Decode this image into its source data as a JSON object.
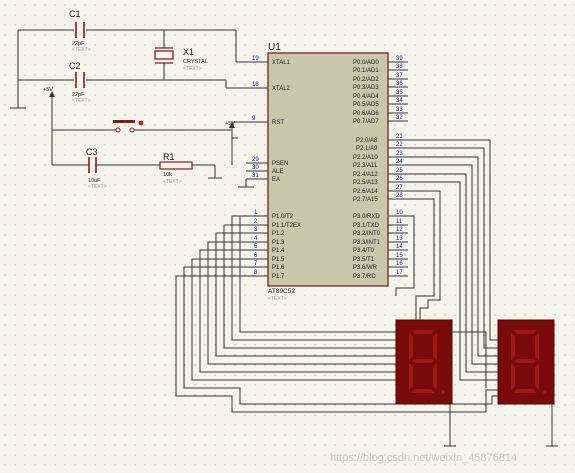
{
  "colors": {
    "background": "#f4f4ec",
    "grid_dot": "#9a9a8a",
    "wire": "#333333",
    "component_outline": "#8b1c1c",
    "chip_fill": "#c8c8ad",
    "chip_border": "#8b1c1c",
    "pin_number": "#1a1a99",
    "label": "#1a1a1a",
    "text_placeholder": "#9a9a9a",
    "segment_display_bg": "#7a0b0b",
    "segment_off": "#a01818",
    "pin_dot": "#2a2a2a"
  },
  "components": {
    "c1": {
      "ref": "C1",
      "value": "22pF",
      "text": "<TEXT>"
    },
    "c2": {
      "ref": "C2",
      "value": "22pF",
      "text": "<TEXT>"
    },
    "c3": {
      "ref": "C3",
      "value": "10uF",
      "text": "<TEXT>"
    },
    "x1": {
      "ref": "X1",
      "value": "CRYSTAL",
      "text": "<TEXT>"
    },
    "r1": {
      "ref": "R1",
      "value": "10k",
      "text": "<TEXT>"
    },
    "u1": {
      "ref": "U1",
      "part": "AT89C52",
      "text": "<TEXT>"
    },
    "power_left": "+5V",
    "power_right": "+5V"
  },
  "u1_left_pins": [
    {
      "num": "19",
      "name": "XTAL1"
    },
    {
      "num": "18",
      "name": "XTAL2"
    },
    {
      "num": "9",
      "name": "RST"
    },
    {
      "num": "29",
      "name": "PSEN"
    },
    {
      "num": "30",
      "name": "ALE"
    },
    {
      "num": "31",
      "name": "EA"
    },
    {
      "num": "1",
      "name": "P1.0/T2"
    },
    {
      "num": "2",
      "name": "P1.1/T2EX"
    },
    {
      "num": "3",
      "name": "P1.2"
    },
    {
      "num": "4",
      "name": "P1.3"
    },
    {
      "num": "5",
      "name": "P1.4"
    },
    {
      "num": "6",
      "name": "P1.5"
    },
    {
      "num": "7",
      "name": "P1.6"
    },
    {
      "num": "8",
      "name": "P1.7"
    }
  ],
  "u1_right_pins": [
    {
      "num": "39",
      "name": "P0.0/AD0"
    },
    {
      "num": "38",
      "name": "P0.1/AD1"
    },
    {
      "num": "37",
      "name": "P0.2/AD2"
    },
    {
      "num": "36",
      "name": "P0.3/AD3"
    },
    {
      "num": "35",
      "name": "P0.4/AD4"
    },
    {
      "num": "34",
      "name": "P0.5/AD5"
    },
    {
      "num": "33",
      "name": "P0.6/AD6"
    },
    {
      "num": "32",
      "name": "P0.7/AD7"
    },
    {
      "num": "21",
      "name": "P2.0/A8"
    },
    {
      "num": "22",
      "name": "P2.1/A9"
    },
    {
      "num": "23",
      "name": "P2.2/A10"
    },
    {
      "num": "24",
      "name": "P2.3/A11"
    },
    {
      "num": "25",
      "name": "P2.4/A12"
    },
    {
      "num": "26",
      "name": "P2.5/A13"
    },
    {
      "num": "27",
      "name": "P2.6/A14"
    },
    {
      "num": "28",
      "name": "P2.7/A15"
    },
    {
      "num": "10",
      "name": "P3.0/RXD"
    },
    {
      "num": "11",
      "name": "P3.1/TXD"
    },
    {
      "num": "12",
      "name": "P3.2/INT0"
    },
    {
      "num": "13",
      "name": "P3.3/INT1"
    },
    {
      "num": "14",
      "name": "P3.4/T0"
    },
    {
      "num": "15",
      "name": "P3.5/T1"
    },
    {
      "num": "16",
      "name": "P3.6/WR"
    },
    {
      "num": "17",
      "name": "P3.7/RD"
    }
  ],
  "watermark": "https://blog.csdn.net/weixin_45876814",
  "displays": [
    {
      "digit": "8",
      "segments_lit": false
    },
    {
      "digit": "8",
      "segments_lit": false
    }
  ]
}
